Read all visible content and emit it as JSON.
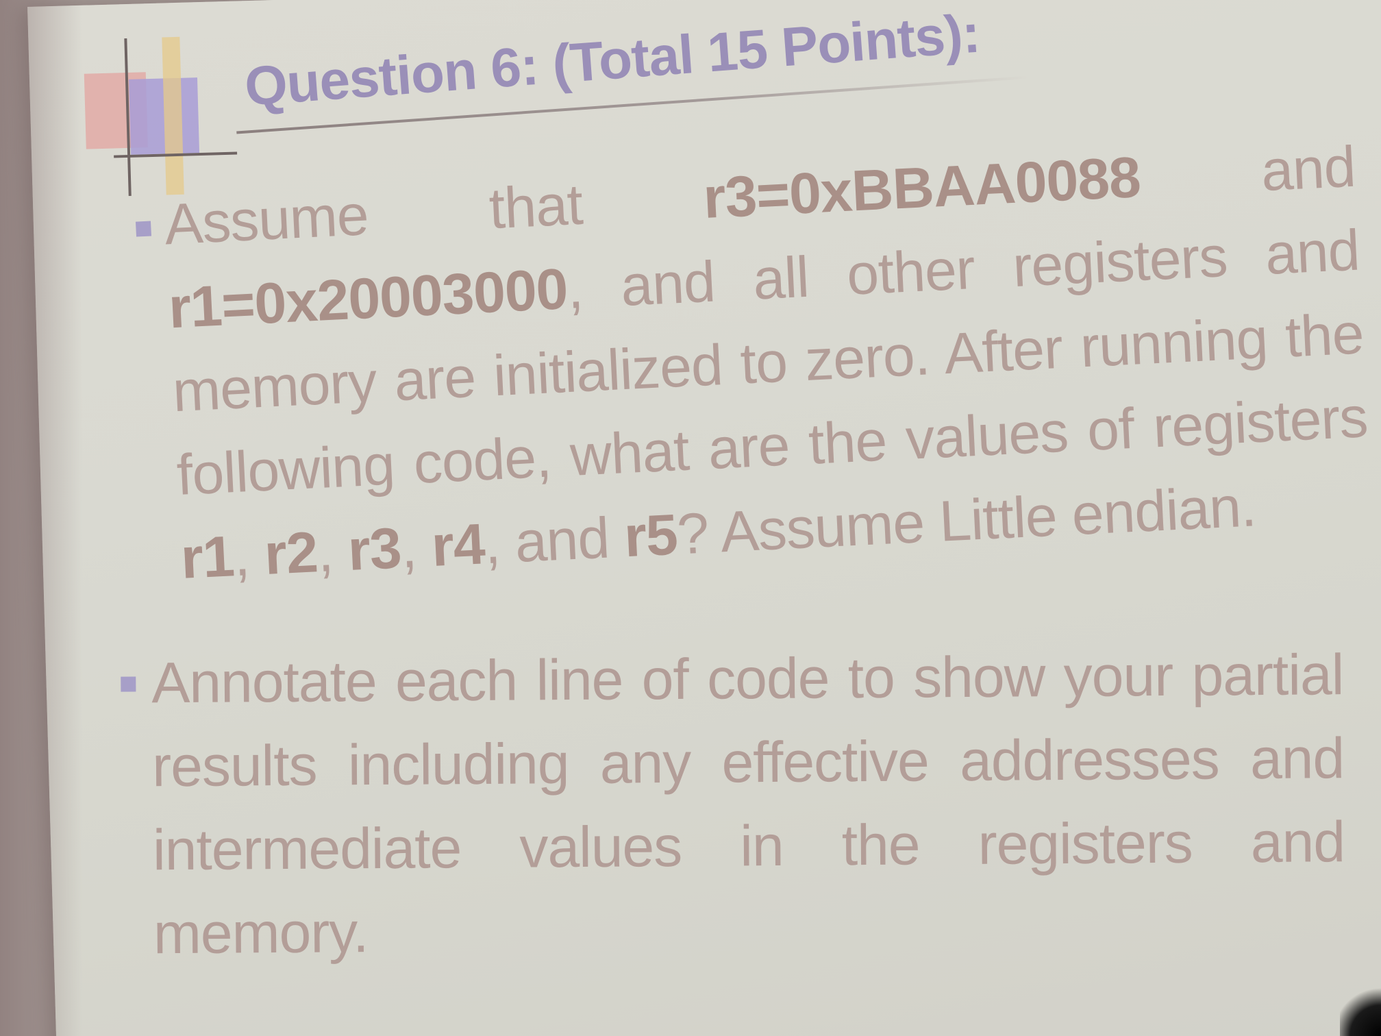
{
  "slide": {
    "title": "Question 6: (Total 15 Points):",
    "bullets": [
      {
        "segments": [
          {
            "text": "Assume that ",
            "bold": false
          },
          {
            "text": "r3=0xBBAA0088",
            "bold": true
          },
          {
            "text": " and ",
            "bold": false
          },
          {
            "text": "r1=0x20003000",
            "bold": true
          },
          {
            "text": ", and all other registers and memory are initialized to zero. After running the following code, what are the values of registers ",
            "bold": false
          },
          {
            "text": "r1",
            "bold": true
          },
          {
            "text": ", ",
            "bold": false
          },
          {
            "text": "r2",
            "bold": true
          },
          {
            "text": ", ",
            "bold": false
          },
          {
            "text": "r3",
            "bold": true
          },
          {
            "text": ", ",
            "bold": false
          },
          {
            "text": "r4",
            "bold": true
          },
          {
            "text": ", and ",
            "bold": false
          },
          {
            "text": "r5",
            "bold": true
          },
          {
            "text": "? Assume Little endian.",
            "bold": false
          }
        ]
      },
      {
        "segments": [
          {
            "text": "Annotate each line of code to show your partial results including any effective addresses and intermediate values in the registers and memory.",
            "bold": false
          }
        ]
      }
    ]
  },
  "colors": {
    "title": "#9a8fb8",
    "body_text": "#b39e98",
    "bullet_marker": "#a79fc8",
    "slide_background": "#d9d9d1"
  }
}
